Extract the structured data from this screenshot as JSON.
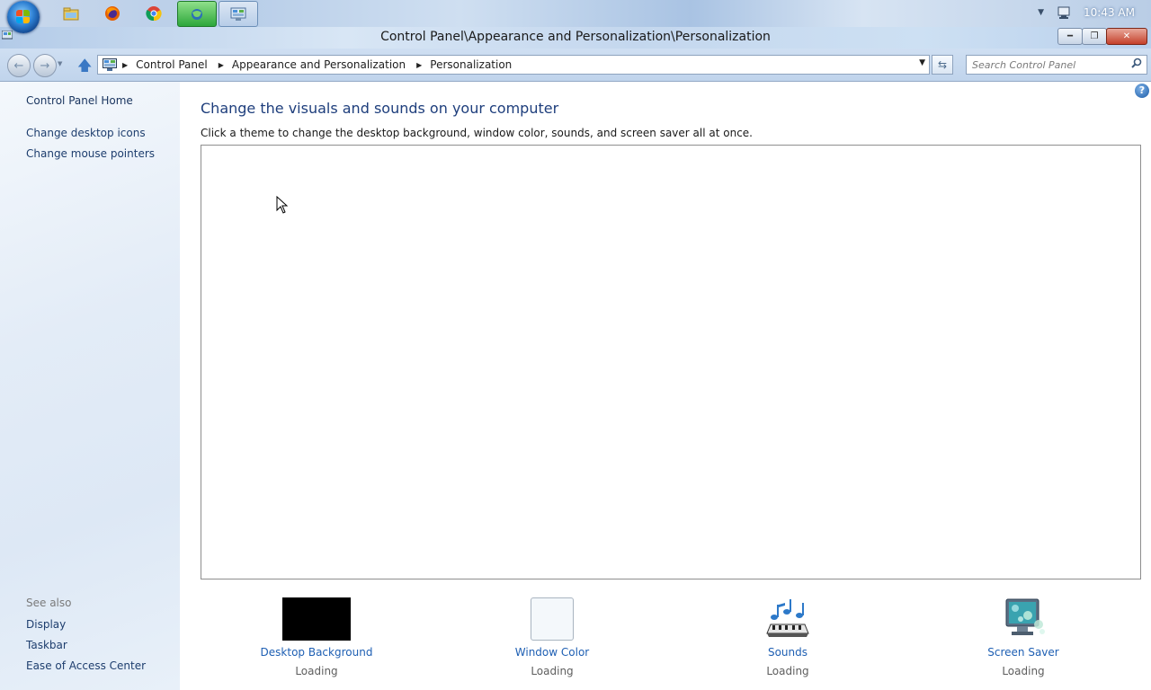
{
  "taskbar": {
    "clock": "10:43 AM",
    "apps": [
      "file-explorer-icon",
      "firefox-icon",
      "chrome-icon",
      "network-app-icon",
      "control-panel-icon"
    ]
  },
  "window": {
    "title": "Control Panel\\Appearance and Personalization\\Personalization"
  },
  "address": {
    "crumbs": [
      "Control Panel",
      "Appearance and Personalization",
      "Personalization"
    ],
    "search_placeholder": "Search Control Panel"
  },
  "sidebar": {
    "home": "Control Panel Home",
    "links": [
      "Change desktop icons",
      "Change mouse pointers"
    ],
    "see_also_label": "See also",
    "see_also": [
      "Display",
      "Taskbar",
      "Ease of Access Center"
    ]
  },
  "main": {
    "title": "Change the visuals and sounds on your computer",
    "subtitle": "Click a theme to change the desktop background, window color, sounds, and screen saver all at once.",
    "bottom_items": [
      {
        "label": "Desktop Background",
        "status": "Loading"
      },
      {
        "label": "Window Color",
        "status": "Loading"
      },
      {
        "label": "Sounds",
        "status": "Loading"
      },
      {
        "label": "Screen Saver",
        "status": "Loading"
      }
    ]
  },
  "colors": {
    "link": "#1e5fb3",
    "title": "#1e3e7c",
    "desktop_background_swatch": "#000000",
    "window_color_swatch": "#f4f8fb"
  }
}
